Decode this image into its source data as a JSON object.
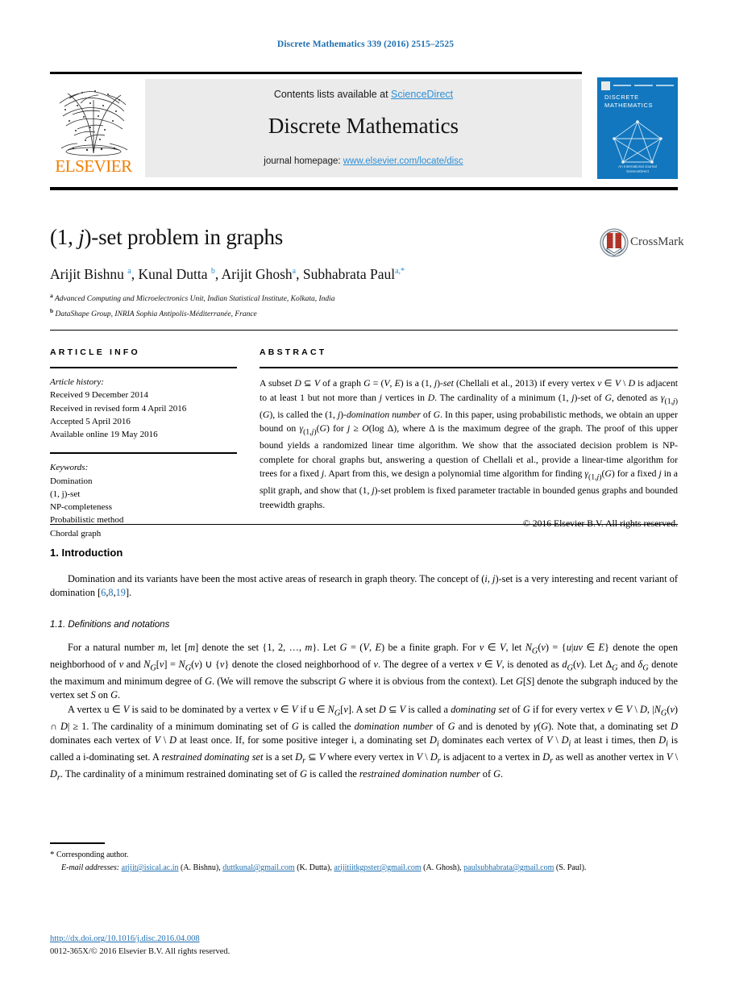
{
  "running_head": "Discrete Mathematics 339 (2016) 2515–2525",
  "masthead": {
    "contents_prefix": "Contents lists available at ",
    "contents_link": "ScienceDirect",
    "journal_name": "Discrete Mathematics",
    "homepage_prefix": "journal homepage: ",
    "homepage_url": "www.elsevier.com/locate/disc",
    "publisher": "ELSEVIER"
  },
  "cover": {
    "title_line1": "DISCRETE",
    "title_line2": "MATHEMATICS",
    "footer_line1": "An International Journal",
    "footer_line2": "ScienceDirect"
  },
  "article": {
    "title_pre": "(1, ",
    "title_ital": "j",
    "title_post": ")-set problem in graphs",
    "crossmark_label": "CrossMark",
    "authors_html": "Arijit Bishnu <sup>a</sup>, Kunal Dutta <sup>b</sup>, Arijit Ghosh<sup>a</sup>, Subhabrata Paul<sup>a,*</sup>",
    "affiliation_a": "Advanced Computing and Microelectronics Unit, Indian Statistical Institute, Kolkata, India",
    "affiliation_b": "DataShape Group, INRIA Sophia Antipolis-Méditerranée, France"
  },
  "info": {
    "heading": "ARTICLE INFO",
    "history_label": "Article history:",
    "history": [
      "Received 9 December 2014",
      "Received in revised form 4 April 2016",
      "Accepted 5 April 2016",
      "Available online 19 May 2016"
    ],
    "keywords_label": "Keywords:",
    "keywords": [
      "Domination",
      "(1, j)-set",
      "NP-completeness",
      "Probabilistic method",
      "Chordal graph"
    ]
  },
  "abstract": {
    "heading": "ABSTRACT",
    "text_html": "A subset <i>D</i> ⊆ <i>V</i> of a graph <i>G</i> = (<i>V</i>, <i>E</i>) is a (1, <i>j</i>)-<i>set</i> (Chellali et al., 2013) if every vertex <i>v</i> ∈ <i>V</i> \\ <i>D</i> is adjacent to at least 1 but not more than <i>j</i> vertices in <i>D</i>. The cardinality of a minimum (1, <i>j</i>)-set of <i>G</i>, denoted as <i>γ</i><sub>(1,<i>j</i>)</sub>(<i>G</i>), is called the (1, <i>j</i>)-<i>domination number</i> of <i>G</i>. In this paper, using probabilistic methods, we obtain an upper bound on <i>γ</i><sub>(1,<i>j</i>)</sub>(<i>G</i>) for <i>j</i> ≥ <i>O</i>(log Δ), where Δ is the maximum degree of the graph. The proof of this upper bound yields a randomized linear time algorithm. We show that the associated decision problem is NP-complete for choral graphs but, answering a question of Chellali et al., provide a linear-time algorithm for trees for a fixed <i>j</i>. Apart from this, we design a polynomial time algorithm for finding <i>γ</i><sub>(1,<i>j</i>)</sub>(<i>G</i>) for a fixed <i>j</i> in a split graph, and show that (1, <i>j</i>)-set problem is fixed parameter tractable in bounded genus graphs and bounded treewidth graphs.",
    "copyright": "© 2016 Elsevier B.V. All rights reserved."
  },
  "sections": {
    "intro_heading": "1. Introduction",
    "intro_para_html": "Domination and its variants have been the most active areas of research in graph theory. The concept of (<i>i</i>, <i>j</i>)-set is a very interesting and recent variant of domination [<a class=\"cite\" href=\"#\">6</a>,<a class=\"cite\" href=\"#\">8</a>,<a class=\"cite\" href=\"#\">19</a>].",
    "defs_heading": "1.1. Definitions and notations",
    "defs_para1_html": "For a natural number <i>m</i>, let [<i>m</i>] denote the set {1, 2, …, <i>m</i>}. Let <i>G</i> = (<i>V</i>, <i>E</i>) be a finite graph. For <i>v</i> ∈ <i>V</i>, let <i>N<sub>G</sub></i>(<i>v</i>) = {<i>u</i>|<i>uv</i> ∈ <i>E</i>} denote the open neighborhood of <i>v</i> and <i>N<sub>G</sub></i>[<i>v</i>] = <i>N<sub>G</sub></i>(<i>v</i>) ∪ {<i>v</i>} denote the closed neighborhood of <i>v</i>. The degree of a vertex <i>v</i> ∈ <i>V</i>, is denoted as <i>d<sub>G</sub></i>(<i>v</i>). Let Δ<i><sub>G</sub></i> and <i>δ<sub>G</sub></i> denote the maximum and minimum degree of <i>G</i>. (We will remove the subscript <i>G</i> where it is obvious from the context). Let <i>G</i>[<i>S</i>] denote the subgraph induced by the vertex set <i>S</i> on <i>G</i>.",
    "defs_para2_html": "A vertex u ∈ <i>V</i> is said to be dominated by a vertex <i>v</i> ∈ <i>V</i> if u ∈ <i>N<sub>G</sub></i>[<i>v</i>]. A set <i>D</i> ⊆ <i>V</i> is called a <i>dominating set</i> of <i>G</i> if for every vertex <i>v</i> ∈ <i>V</i> \\ <i>D</i>, |<i>N<sub>G</sub></i>(<i>v</i>) ∩ <i>D</i>| ≥ 1. The cardinality of a minimum dominating set of <i>G</i> is called the <i>domination number</i> of <i>G</i> and is denoted by <i>γ</i>(<i>G</i>). Note that, a dominating set <i>D</i> dominates each vertex of <i>V</i> \\ <i>D</i> at least once. If, for some positive integer i, a dominating set <i>D<sub>i</sub></i> dominates each vertex of <i>V</i> \\ <i>D<sub>i</sub></i> at least i times, then <i>D<sub>i</sub></i> is called a i-dominating set. A <i>restrained dominating set</i> is a set <i>D<sub>r</sub></i> ⊆ <i>V</i> where every vertex in <i>V</i> \\ <i>D<sub>r</sub></i> is adjacent to a vertex in <i>D<sub>r</sub></i> as well as another vertex in <i>V</i> \\ <i>D<sub>r</sub></i>. The cardinality of a minimum restrained dominating set of <i>G</i> is called the <i>restrained domination number</i> of <i>G</i>."
  },
  "footnotes": {
    "corresponding": "Corresponding author.",
    "emails_label": "E-mail addresses:",
    "emails": [
      {
        "address": "arijit@isical.ac.in",
        "name": "(A. Bishnu)"
      },
      {
        "address": "duttkunal@gmail.com",
        "name": "(K. Dutta)"
      },
      {
        "address": "arijitiitkgpster@gmail.com",
        "name": "(A. Ghosh)"
      },
      {
        "address": "paulsubhabrata@gmail.com",
        "name": "(S. Paul)."
      }
    ],
    "doi": "http://dx.doi.org/10.1016/j.disc.2016.04.008",
    "issn": "0012-365X/© 2016 Elsevier B.V. All rights reserved."
  },
  "colors": {
    "link": "#1f6fb0",
    "sciencedirect": "#2d8fd5",
    "elsevier_orange": "#ef7d00",
    "cover_blue": "#1277be"
  }
}
